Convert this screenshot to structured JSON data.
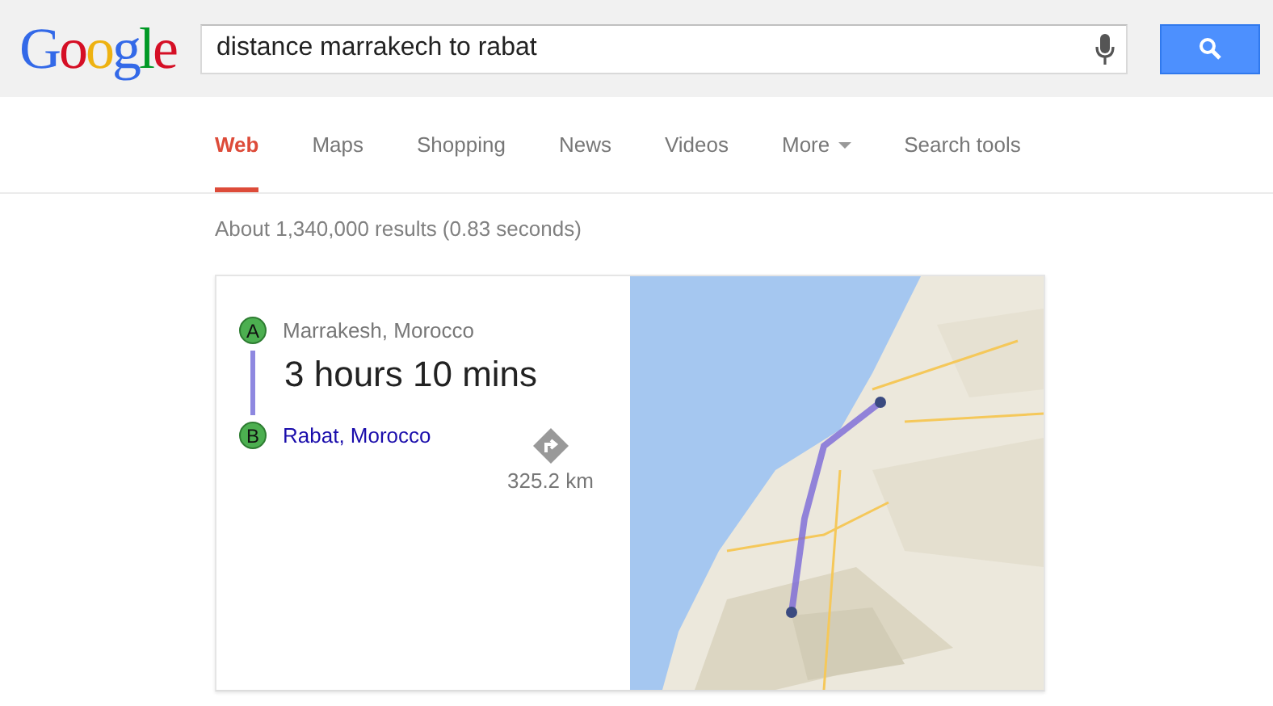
{
  "header": {
    "logo": "Google",
    "search": {
      "value": "distance marrakech to rabat"
    }
  },
  "tabs": [
    {
      "label": "Web",
      "selected": true,
      "kind": "tab"
    },
    {
      "label": "Maps",
      "selected": false,
      "kind": "tab"
    },
    {
      "label": "Shopping",
      "selected": false,
      "kind": "tab"
    },
    {
      "label": "News",
      "selected": false,
      "kind": "tab"
    },
    {
      "label": "Videos",
      "selected": false,
      "kind": "tab"
    },
    {
      "label": "More",
      "selected": false,
      "kind": "menu"
    },
    {
      "label": "Search tools",
      "selected": false,
      "kind": "tab"
    }
  ],
  "result_stats": "About 1,340,000 results (0.83 seconds)",
  "directions": {
    "origin": {
      "marker": "A",
      "place": "Marrakesh, Morocco"
    },
    "duration": "3 hours 10 mins",
    "destination": {
      "marker": "B",
      "place": "Rabat, Morocco"
    },
    "distance": "325.2 km"
  }
}
